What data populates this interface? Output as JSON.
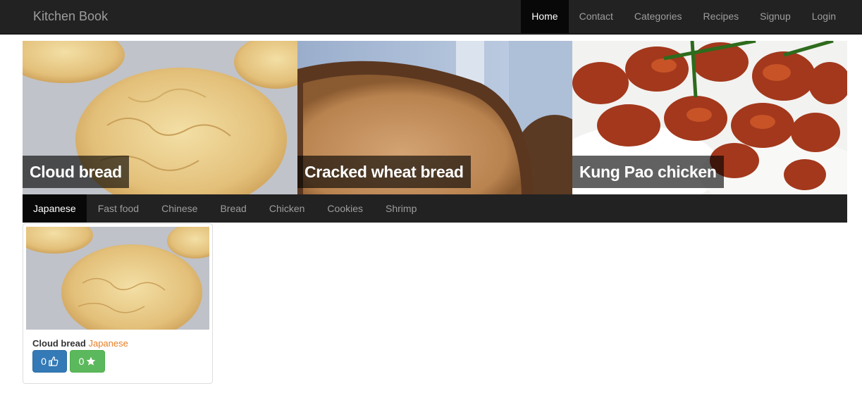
{
  "navbar": {
    "brand": "Kitchen Book",
    "items": [
      {
        "label": "Home",
        "active": true
      },
      {
        "label": "Contact"
      },
      {
        "label": "Categories"
      },
      {
        "label": "Recipes"
      },
      {
        "label": "Signup"
      },
      {
        "label": "Login"
      }
    ]
  },
  "hero": {
    "items": [
      {
        "caption": "Cloud bread"
      },
      {
        "caption": "Cracked wheat bread"
      },
      {
        "caption": "Kung Pao chicken"
      }
    ]
  },
  "categories": {
    "items": [
      {
        "label": "Japanese",
        "active": true
      },
      {
        "label": "Fast food"
      },
      {
        "label": "Chinese"
      },
      {
        "label": "Bread"
      },
      {
        "label": "Chicken"
      },
      {
        "label": "Cookies"
      },
      {
        "label": "Shrimp"
      }
    ]
  },
  "recipe_card": {
    "name": "Cloud bread",
    "category": "Japanese",
    "likes": "0",
    "favorites": "0"
  },
  "colors": {
    "navbar_bg": "#222222",
    "active_bg": "#080808",
    "like_button": "#337ab7",
    "fav_button": "#5cb85c",
    "category_text": "#e67e22"
  },
  "icons": {
    "like": "thumbs-up-icon",
    "favorite": "star-icon"
  }
}
